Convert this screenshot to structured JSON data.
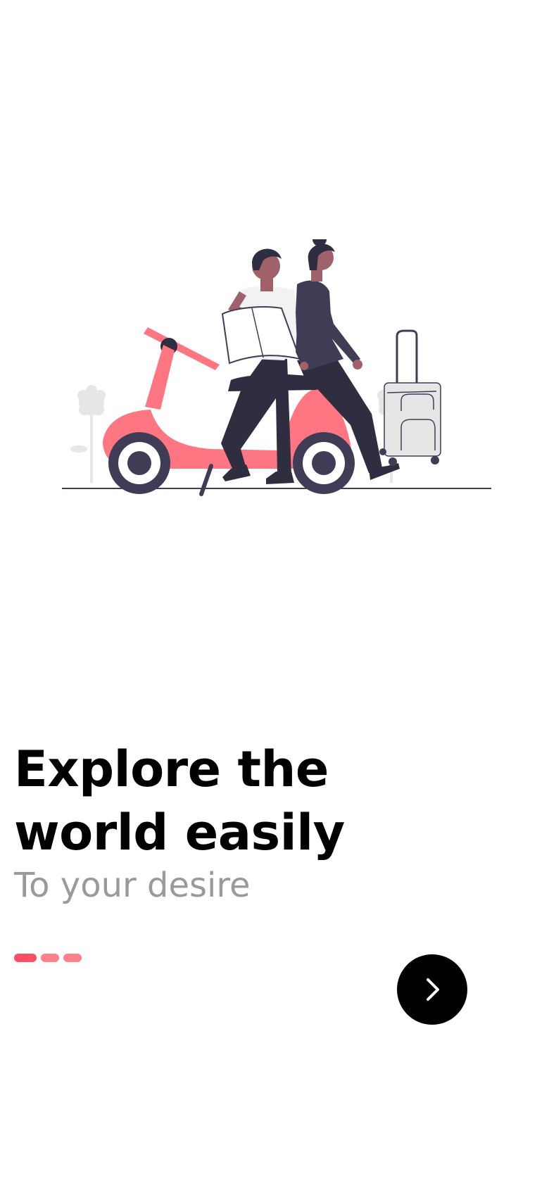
{
  "onboarding": {
    "illustration_name": "couple-with-scooter-and-suitcase",
    "headline_line1": "Explore the",
    "headline_line2": "world easily",
    "subtitle": "To your desire",
    "page_indicator": {
      "current": 1,
      "total": 3
    },
    "next_icon": "chevron-right-icon"
  },
  "colors": {
    "accent": "#ff4d64",
    "accent_light": "#ff7f8c",
    "scooter": "#ff7683",
    "dark": "#2f2e41",
    "skin": "#a0616a",
    "subtitle": "#9a9a9a",
    "button": "#000000"
  }
}
